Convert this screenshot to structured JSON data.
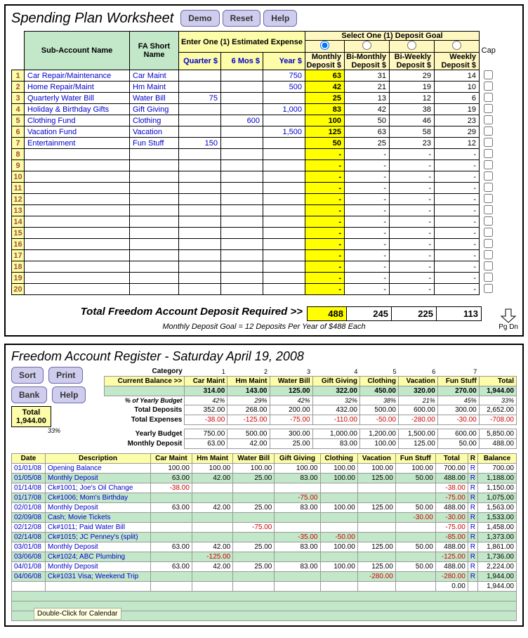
{
  "worksheet": {
    "title": "Spending Plan Worksheet",
    "buttons": {
      "demo": "Demo",
      "reset": "Reset",
      "help": "Help"
    },
    "select_goal_label": "Select One (1) Deposit Goal",
    "headers": {
      "sub_account": "Sub-Account Name",
      "fa_short": "FA Short Name",
      "est_expense": "Enter One (1) Estimated Expense",
      "quarter": "Quarter $",
      "sixmos": "6 Mos $",
      "year": "Year $",
      "monthly": "Monthly Deposit $",
      "bimonthly": "Bi-Monthly Deposit $",
      "biweekly": "Bi-Weekly Deposit $",
      "weekly": "Weekly Deposit $",
      "cap": "Cap"
    },
    "rows": [
      {
        "n": "1",
        "name": "Car Repair/Maintenance",
        "fa": "Car Maint",
        "q": "",
        "s": "",
        "y": "750",
        "m": "63",
        "bm": "31",
        "bw": "29",
        "w": "14"
      },
      {
        "n": "2",
        "name": "Home Repair/Maint",
        "fa": "Hm Maint",
        "q": "",
        "s": "",
        "y": "500",
        "m": "42",
        "bm": "21",
        "bw": "19",
        "w": "10"
      },
      {
        "n": "3",
        "name": "Quarterly Water Bill",
        "fa": "Water Bill",
        "q": "75",
        "s": "",
        "y": "",
        "m": "25",
        "bm": "13",
        "bw": "12",
        "w": "6"
      },
      {
        "n": "4",
        "name": "Holiday & Birthday Gifts",
        "fa": "Gift Giving",
        "q": "",
        "s": "",
        "y": "1,000",
        "m": "83",
        "bm": "42",
        "bw": "38",
        "w": "19"
      },
      {
        "n": "5",
        "name": "Clothing Fund",
        "fa": "Clothing",
        "q": "",
        "s": "600",
        "y": "",
        "m": "100",
        "bm": "50",
        "bw": "46",
        "w": "23"
      },
      {
        "n": "6",
        "name": "Vacation Fund",
        "fa": "Vacation",
        "q": "",
        "s": "",
        "y": "1,500",
        "m": "125",
        "bm": "63",
        "bw": "58",
        "w": "29"
      },
      {
        "n": "7",
        "name": "Entertainment",
        "fa": "Fun Stuff",
        "q": "150",
        "s": "",
        "y": "",
        "m": "50",
        "bm": "25",
        "bw": "23",
        "w": "12"
      },
      {
        "n": "8",
        "name": "",
        "fa": "",
        "q": "",
        "s": "",
        "y": "",
        "m": "-",
        "bm": "-",
        "bw": "-",
        "w": "-"
      },
      {
        "n": "9",
        "name": "",
        "fa": "",
        "q": "",
        "s": "",
        "y": "",
        "m": "-",
        "bm": "-",
        "bw": "-",
        "w": "-"
      },
      {
        "n": "10",
        "name": "",
        "fa": "",
        "q": "",
        "s": "",
        "y": "",
        "m": "-",
        "bm": "-",
        "bw": "-",
        "w": "-"
      },
      {
        "n": "11",
        "name": "",
        "fa": "",
        "q": "",
        "s": "",
        "y": "",
        "m": "-",
        "bm": "-",
        "bw": "-",
        "w": "-"
      },
      {
        "n": "12",
        "name": "",
        "fa": "",
        "q": "",
        "s": "",
        "y": "",
        "m": "-",
        "bm": "-",
        "bw": "-",
        "w": "-"
      },
      {
        "n": "13",
        "name": "",
        "fa": "",
        "q": "",
        "s": "",
        "y": "",
        "m": "-",
        "bm": "-",
        "bw": "-",
        "w": "-"
      },
      {
        "n": "14",
        "name": "",
        "fa": "",
        "q": "",
        "s": "",
        "y": "",
        "m": "-",
        "bm": "-",
        "bw": "-",
        "w": "-"
      },
      {
        "n": "15",
        "name": "",
        "fa": "",
        "q": "",
        "s": "",
        "y": "",
        "m": "-",
        "bm": "-",
        "bw": "-",
        "w": "-"
      },
      {
        "n": "16",
        "name": "",
        "fa": "",
        "q": "",
        "s": "",
        "y": "",
        "m": "-",
        "bm": "-",
        "bw": "-",
        "w": "-"
      },
      {
        "n": "17",
        "name": "",
        "fa": "",
        "q": "",
        "s": "",
        "y": "",
        "m": "-",
        "bm": "-",
        "bw": "-",
        "w": "-"
      },
      {
        "n": "18",
        "name": "",
        "fa": "",
        "q": "",
        "s": "",
        "y": "",
        "m": "-",
        "bm": "-",
        "bw": "-",
        "w": "-"
      },
      {
        "n": "19",
        "name": "",
        "fa": "",
        "q": "",
        "s": "",
        "y": "",
        "m": "-",
        "bm": "-",
        "bw": "-",
        "w": "-"
      },
      {
        "n": "20",
        "name": "",
        "fa": "",
        "q": "",
        "s": "",
        "y": "",
        "m": "-",
        "bm": "-",
        "bw": "-",
        "w": "-"
      }
    ],
    "totals": {
      "label": "Total Freedom Account Deposit Required  >>",
      "m": "488",
      "bm": "245",
      "bw": "225",
      "w": "113"
    },
    "footnote": "Monthly Deposit Goal = 12 Deposits Per Year of $488 Each",
    "pgdn": "Pg Dn"
  },
  "register": {
    "title": "Freedom Account Register - Saturday April 19, 2008",
    "buttons": {
      "sort": "Sort",
      "print": "Print",
      "bank": "Bank",
      "help": "Help"
    },
    "labels": {
      "category": "Category",
      "curbal": "Current Balance >>",
      "pct": "% of Yearly Budget",
      "totdep": "Total Deposits",
      "totexp": "Total Expenses",
      "yb": "Yearly Budget",
      "md": "Monthly Deposit",
      "total": "Total",
      "date": "Date",
      "desc": "Description",
      "r": "R",
      "bal": "Balance"
    },
    "cat_nums": [
      "1",
      "2",
      "3",
      "4",
      "5",
      "6",
      "7",
      ""
    ],
    "cats": [
      "Car Maint",
      "Hm Maint",
      "Water Bill",
      "Gift Giving",
      "Clothing",
      "Vacation",
      "Fun Stuff",
      "Total"
    ],
    "curbal": [
      "314.00",
      "143.00",
      "125.00",
      "322.00",
      "450.00",
      "320.00",
      "270.00",
      "1,944.00"
    ],
    "pct": [
      "42%",
      "29%",
      "42%",
      "32%",
      "38%",
      "21%",
      "45%",
      "33%"
    ],
    "totdep": [
      "352.00",
      "268.00",
      "200.00",
      "432.00",
      "500.00",
      "600.00",
      "300.00",
      "2,652.00"
    ],
    "totexp": [
      "-38.00",
      "-125.00",
      "-75.00",
      "-110.00",
      "-50.00",
      "-280.00",
      "-30.00",
      "-708.00"
    ],
    "yb": [
      "750.00",
      "500.00",
      "300.00",
      "1,000.00",
      "1,200.00",
      "1,500.00",
      "600.00",
      "5,850.00"
    ],
    "md": [
      "63.00",
      "42.00",
      "25.00",
      "83.00",
      "100.00",
      "125.00",
      "50.00",
      "488.00"
    ],
    "totalbox": {
      "label": "Total",
      "amount": "1,944.00",
      "pct": "33%"
    },
    "tx": [
      {
        "d": "01/01/08",
        "desc": "Opening Balance",
        "v": [
          "100.00",
          "100.00",
          "100.00",
          "100.00",
          "100.00",
          "100.00",
          "100.00"
        ],
        "neg": [
          0,
          0,
          0,
          0,
          0,
          0,
          0
        ],
        "tot": "700.00",
        "tneg": 0,
        "r": "R",
        "bal": "700.00",
        "g": 0
      },
      {
        "d": "01/05/08",
        "desc": "Monthly Deposit",
        "v": [
          "63.00",
          "42.00",
          "25.00",
          "83.00",
          "100.00",
          "125.00",
          "50.00"
        ],
        "neg": [
          0,
          0,
          0,
          0,
          0,
          0,
          0
        ],
        "tot": "488.00",
        "tneg": 0,
        "r": "R",
        "bal": "1,188.00",
        "g": 1
      },
      {
        "d": "01/14/08",
        "desc": "Ck#1001; Joe's Oil Change",
        "v": [
          "-38.00",
          "",
          "",
          "",
          "",
          "",
          ""
        ],
        "neg": [
          1,
          0,
          0,
          0,
          0,
          0,
          0
        ],
        "tot": "-38.00",
        "tneg": 1,
        "r": "R",
        "bal": "1,150.00",
        "g": 0
      },
      {
        "d": "01/17/08",
        "desc": "Ck#1006; Mom's Birthday",
        "v": [
          "",
          "",
          "",
          "-75.00",
          "",
          "",
          ""
        ],
        "neg": [
          0,
          0,
          0,
          1,
          0,
          0,
          0
        ],
        "tot": "-75.00",
        "tneg": 1,
        "r": "R",
        "bal": "1,075.00",
        "g": 1
      },
      {
        "d": "02/01/08",
        "desc": "Monthly Deposit",
        "v": [
          "63.00",
          "42.00",
          "25.00",
          "83.00",
          "100.00",
          "125.00",
          "50.00"
        ],
        "neg": [
          0,
          0,
          0,
          0,
          0,
          0,
          0
        ],
        "tot": "488.00",
        "tneg": 0,
        "r": "R",
        "bal": "1,563.00",
        "g": 0
      },
      {
        "d": "02/09/08",
        "desc": "Cash; Movie Tickets",
        "v": [
          "",
          "",
          "",
          "",
          "",
          "",
          "-30.00"
        ],
        "neg": [
          0,
          0,
          0,
          0,
          0,
          0,
          1
        ],
        "tot": "-30.00",
        "tneg": 1,
        "r": "R",
        "bal": "1,533.00",
        "g": 1
      },
      {
        "d": "02/12/08",
        "desc": "Ck#1011; Paid Water Bill",
        "v": [
          "",
          "",
          "-75.00",
          "",
          "",
          "",
          ""
        ],
        "neg": [
          0,
          0,
          1,
          0,
          0,
          0,
          0
        ],
        "tot": "-75.00",
        "tneg": 1,
        "r": "R",
        "bal": "1,458.00",
        "g": 0
      },
      {
        "d": "02/14/08",
        "desc": "Ck#1015; JC Penney's (split)",
        "v": [
          "",
          "",
          "",
          "-35.00",
          "-50.00",
          "",
          ""
        ],
        "neg": [
          0,
          0,
          0,
          1,
          1,
          0,
          0
        ],
        "tot": "-85.00",
        "tneg": 1,
        "r": "R",
        "bal": "1,373.00",
        "g": 1
      },
      {
        "d": "03/01/08",
        "desc": "Monthly Deposit",
        "v": [
          "63.00",
          "42.00",
          "25.00",
          "83.00",
          "100.00",
          "125.00",
          "50.00"
        ],
        "neg": [
          0,
          0,
          0,
          0,
          0,
          0,
          0
        ],
        "tot": "488.00",
        "tneg": 0,
        "r": "R",
        "bal": "1,861.00",
        "g": 0
      },
      {
        "d": "03/06/08",
        "desc": "Ck#1024; ABC Plumbing",
        "v": [
          "",
          "-125.00",
          "",
          "",
          "",
          "",
          ""
        ],
        "neg": [
          0,
          1,
          0,
          0,
          0,
          0,
          0
        ],
        "tot": "-125.00",
        "tneg": 1,
        "r": "R",
        "bal": "1,736.00",
        "g": 1
      },
      {
        "d": "04/01/08",
        "desc": "Monthly Deposit",
        "v": [
          "63.00",
          "42.00",
          "25.00",
          "83.00",
          "100.00",
          "125.00",
          "50.00"
        ],
        "neg": [
          0,
          0,
          0,
          0,
          0,
          0,
          0
        ],
        "tot": "488.00",
        "tneg": 0,
        "r": "R",
        "bal": "2,224.00",
        "g": 0
      },
      {
        "d": "04/06/08",
        "desc": "Ck#1031 Visa; Weekend Trip",
        "v": [
          "",
          "",
          "",
          "",
          "",
          "-280.00",
          ""
        ],
        "neg": [
          0,
          0,
          0,
          0,
          0,
          1,
          0
        ],
        "tot": "-280.00",
        "tneg": 1,
        "r": "R",
        "bal": "1,944.00",
        "g": 1
      },
      {
        "d": "",
        "desc": "",
        "v": [
          "",
          "",
          "",
          "",
          "",
          "",
          ""
        ],
        "neg": [
          0,
          0,
          0,
          0,
          0,
          0,
          0
        ],
        "tot": "0.00",
        "tneg": 0,
        "r": "",
        "bal": "1,944.00",
        "g": 0
      }
    ],
    "tooltip": "Double-Click for Calendar"
  }
}
